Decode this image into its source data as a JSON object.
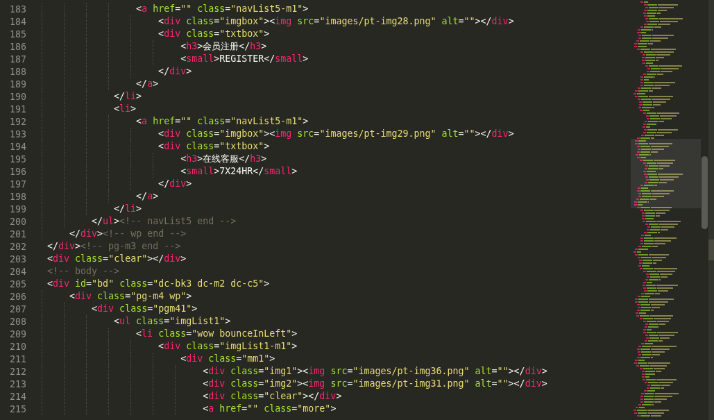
{
  "editor": {
    "lines": [
      {
        "number": "183",
        "tokens": [
          {
            "kind": "punct",
            "text": "                <"
          },
          {
            "kind": "tag",
            "text": "a"
          },
          {
            "kind": "attr",
            "text": " href"
          },
          {
            "kind": "punct",
            "text": "="
          },
          {
            "kind": "string",
            "text": "\"\""
          },
          {
            "kind": "attr",
            "text": " class"
          },
          {
            "kind": "punct",
            "text": "="
          },
          {
            "kind": "string",
            "text": "\"navList5-m1\""
          },
          {
            "kind": "punct",
            "text": ">"
          }
        ]
      },
      {
        "number": "184",
        "tokens": [
          {
            "kind": "punct",
            "text": "                    <"
          },
          {
            "kind": "tag",
            "text": "div"
          },
          {
            "kind": "attr",
            "text": " class"
          },
          {
            "kind": "punct",
            "text": "="
          },
          {
            "kind": "string",
            "text": "\"imgbox\""
          },
          {
            "kind": "punct",
            "text": "><"
          },
          {
            "kind": "tag",
            "text": "img"
          },
          {
            "kind": "attr",
            "text": " src"
          },
          {
            "kind": "punct",
            "text": "="
          },
          {
            "kind": "string",
            "text": "\"images/pt-img28.png\""
          },
          {
            "kind": "attr",
            "text": " alt"
          },
          {
            "kind": "punct",
            "text": "="
          },
          {
            "kind": "string",
            "text": "\"\""
          },
          {
            "kind": "punct",
            "text": "></"
          },
          {
            "kind": "tag",
            "text": "div"
          },
          {
            "kind": "punct",
            "text": ">"
          }
        ]
      },
      {
        "number": "185",
        "tokens": [
          {
            "kind": "punct",
            "text": "                    <"
          },
          {
            "kind": "tag",
            "text": "div"
          },
          {
            "kind": "attr",
            "text": " class"
          },
          {
            "kind": "punct",
            "text": "="
          },
          {
            "kind": "string",
            "text": "\"txtbox\""
          },
          {
            "kind": "punct",
            "text": ">"
          }
        ]
      },
      {
        "number": "186",
        "tokens": [
          {
            "kind": "punct",
            "text": "                        <"
          },
          {
            "kind": "tag",
            "text": "h3"
          },
          {
            "kind": "punct",
            "text": ">会员注册</"
          },
          {
            "kind": "tag",
            "text": "h3"
          },
          {
            "kind": "punct",
            "text": ">"
          }
        ]
      },
      {
        "number": "187",
        "tokens": [
          {
            "kind": "punct",
            "text": "                        <"
          },
          {
            "kind": "tag",
            "text": "small"
          },
          {
            "kind": "punct",
            "text": ">REGISTER</"
          },
          {
            "kind": "tag",
            "text": "small"
          },
          {
            "kind": "punct",
            "text": ">"
          }
        ]
      },
      {
        "number": "188",
        "tokens": [
          {
            "kind": "punct",
            "text": "                    </"
          },
          {
            "kind": "tag",
            "text": "div"
          },
          {
            "kind": "punct",
            "text": ">"
          }
        ]
      },
      {
        "number": "189",
        "tokens": [
          {
            "kind": "punct",
            "text": "                </"
          },
          {
            "kind": "tag",
            "text": "a"
          },
          {
            "kind": "punct",
            "text": ">"
          }
        ]
      },
      {
        "number": "190",
        "tokens": [
          {
            "kind": "punct",
            "text": "            </"
          },
          {
            "kind": "tag",
            "text": "li"
          },
          {
            "kind": "punct",
            "text": ">"
          }
        ]
      },
      {
        "number": "191",
        "tokens": [
          {
            "kind": "punct",
            "text": "            <"
          },
          {
            "kind": "tag",
            "text": "li"
          },
          {
            "kind": "punct",
            "text": ">"
          }
        ]
      },
      {
        "number": "192",
        "tokens": [
          {
            "kind": "punct",
            "text": "                <"
          },
          {
            "kind": "tag",
            "text": "a"
          },
          {
            "kind": "attr",
            "text": " href"
          },
          {
            "kind": "punct",
            "text": "="
          },
          {
            "kind": "string",
            "text": "\"\""
          },
          {
            "kind": "attr",
            "text": " class"
          },
          {
            "kind": "punct",
            "text": "="
          },
          {
            "kind": "string",
            "text": "\"navList5-m1\""
          },
          {
            "kind": "punct",
            "text": ">"
          }
        ]
      },
      {
        "number": "193",
        "tokens": [
          {
            "kind": "punct",
            "text": "                    <"
          },
          {
            "kind": "tag",
            "text": "div"
          },
          {
            "kind": "attr",
            "text": " class"
          },
          {
            "kind": "punct",
            "text": "="
          },
          {
            "kind": "string",
            "text": "\"imgbox\""
          },
          {
            "kind": "punct",
            "text": "><"
          },
          {
            "kind": "tag",
            "text": "img"
          },
          {
            "kind": "attr",
            "text": " src"
          },
          {
            "kind": "punct",
            "text": "="
          },
          {
            "kind": "string",
            "text": "\"images/pt-img29.png\""
          },
          {
            "kind": "attr",
            "text": " alt"
          },
          {
            "kind": "punct",
            "text": "="
          },
          {
            "kind": "string",
            "text": "\"\""
          },
          {
            "kind": "punct",
            "text": "></"
          },
          {
            "kind": "tag",
            "text": "div"
          },
          {
            "kind": "punct",
            "text": ">"
          }
        ]
      },
      {
        "number": "194",
        "tokens": [
          {
            "kind": "punct",
            "text": "                    <"
          },
          {
            "kind": "tag",
            "text": "div"
          },
          {
            "kind": "attr",
            "text": " class"
          },
          {
            "kind": "punct",
            "text": "="
          },
          {
            "kind": "string",
            "text": "\"txtbox\""
          },
          {
            "kind": "punct",
            "text": ">"
          }
        ]
      },
      {
        "number": "195",
        "tokens": [
          {
            "kind": "punct",
            "text": "                        <"
          },
          {
            "kind": "tag",
            "text": "h3"
          },
          {
            "kind": "punct",
            "text": ">在线客服</"
          },
          {
            "kind": "tag",
            "text": "h3"
          },
          {
            "kind": "punct",
            "text": ">"
          }
        ]
      },
      {
        "number": "196",
        "tokens": [
          {
            "kind": "punct",
            "text": "                        <"
          },
          {
            "kind": "tag",
            "text": "small"
          },
          {
            "kind": "punct",
            "text": ">7X24HR</"
          },
          {
            "kind": "tag",
            "text": "small"
          },
          {
            "kind": "punct",
            "text": ">"
          }
        ]
      },
      {
        "number": "197",
        "tokens": [
          {
            "kind": "punct",
            "text": "                    </"
          },
          {
            "kind": "tag",
            "text": "div"
          },
          {
            "kind": "punct",
            "text": ">"
          }
        ]
      },
      {
        "number": "198",
        "tokens": [
          {
            "kind": "punct",
            "text": "                </"
          },
          {
            "kind": "tag",
            "text": "a"
          },
          {
            "kind": "punct",
            "text": ">"
          }
        ]
      },
      {
        "number": "199",
        "tokens": [
          {
            "kind": "punct",
            "text": "            </"
          },
          {
            "kind": "tag",
            "text": "li"
          },
          {
            "kind": "punct",
            "text": ">"
          }
        ]
      },
      {
        "number": "200",
        "tokens": [
          {
            "kind": "punct",
            "text": "        </"
          },
          {
            "kind": "tag",
            "text": "ul"
          },
          {
            "kind": "punct",
            "text": ">"
          },
          {
            "kind": "comment",
            "text": "<!-- navList5 end -->"
          }
        ]
      },
      {
        "number": "201",
        "tokens": [
          {
            "kind": "punct",
            "text": "    </"
          },
          {
            "kind": "tag",
            "text": "div"
          },
          {
            "kind": "punct",
            "text": ">"
          },
          {
            "kind": "comment",
            "text": "<!-- wp end -->"
          }
        ]
      },
      {
        "number": "202",
        "tokens": [
          {
            "kind": "punct",
            "text": "</"
          },
          {
            "kind": "tag",
            "text": "div"
          },
          {
            "kind": "punct",
            "text": ">"
          },
          {
            "kind": "comment",
            "text": "<!-- pg-m3 end -->"
          }
        ]
      },
      {
        "number": "203",
        "tokens": [
          {
            "kind": "punct",
            "text": "<"
          },
          {
            "kind": "tag",
            "text": "div"
          },
          {
            "kind": "attr",
            "text": " class"
          },
          {
            "kind": "punct",
            "text": "="
          },
          {
            "kind": "string",
            "text": "\"clear\""
          },
          {
            "kind": "punct",
            "text": "></"
          },
          {
            "kind": "tag",
            "text": "div"
          },
          {
            "kind": "punct",
            "text": ">"
          }
        ]
      },
      {
        "number": "204",
        "tokens": [
          {
            "kind": "comment",
            "text": "<!-- body -->"
          }
        ]
      },
      {
        "number": "205",
        "tokens": [
          {
            "kind": "punct",
            "text": "<"
          },
          {
            "kind": "tag",
            "text": "div"
          },
          {
            "kind": "attr",
            "text": " id"
          },
          {
            "kind": "punct",
            "text": "="
          },
          {
            "kind": "string",
            "text": "\"bd\""
          },
          {
            "kind": "attr",
            "text": " class"
          },
          {
            "kind": "punct",
            "text": "="
          },
          {
            "kind": "string",
            "text": "\"dc-bk3 dc-m2 dc-c5\""
          },
          {
            "kind": "punct",
            "text": ">"
          }
        ]
      },
      {
        "number": "206",
        "tokens": [
          {
            "kind": "punct",
            "text": "    <"
          },
          {
            "kind": "tag",
            "text": "div"
          },
          {
            "kind": "attr",
            "text": " class"
          },
          {
            "kind": "punct",
            "text": "="
          },
          {
            "kind": "string",
            "text": "\"pg-m4 wp\""
          },
          {
            "kind": "punct",
            "text": ">"
          }
        ]
      },
      {
        "number": "207",
        "tokens": [
          {
            "kind": "punct",
            "text": "        <"
          },
          {
            "kind": "tag",
            "text": "div"
          },
          {
            "kind": "attr",
            "text": " class"
          },
          {
            "kind": "punct",
            "text": "="
          },
          {
            "kind": "string",
            "text": "\"pgm41\""
          },
          {
            "kind": "punct",
            "text": ">"
          }
        ]
      },
      {
        "number": "208",
        "tokens": [
          {
            "kind": "punct",
            "text": "            <"
          },
          {
            "kind": "tag",
            "text": "ul"
          },
          {
            "kind": "attr",
            "text": " class"
          },
          {
            "kind": "punct",
            "text": "="
          },
          {
            "kind": "string",
            "text": "\"imgList1\""
          },
          {
            "kind": "punct",
            "text": ">"
          }
        ]
      },
      {
        "number": "209",
        "tokens": [
          {
            "kind": "punct",
            "text": "                <"
          },
          {
            "kind": "tag",
            "text": "li"
          },
          {
            "kind": "attr",
            "text": " class"
          },
          {
            "kind": "punct",
            "text": "="
          },
          {
            "kind": "string",
            "text": "\"wow bounceInLeft\""
          },
          {
            "kind": "punct",
            "text": ">"
          }
        ]
      },
      {
        "number": "210",
        "tokens": [
          {
            "kind": "punct",
            "text": "                    <"
          },
          {
            "kind": "tag",
            "text": "div"
          },
          {
            "kind": "attr",
            "text": " class"
          },
          {
            "kind": "punct",
            "text": "="
          },
          {
            "kind": "string",
            "text": "\"imgList1-m1\""
          },
          {
            "kind": "punct",
            "text": ">"
          }
        ]
      },
      {
        "number": "211",
        "tokens": [
          {
            "kind": "punct",
            "text": "                        <"
          },
          {
            "kind": "tag",
            "text": "div"
          },
          {
            "kind": "attr",
            "text": " class"
          },
          {
            "kind": "punct",
            "text": "="
          },
          {
            "kind": "string",
            "text": "\"mm1\""
          },
          {
            "kind": "punct",
            "text": ">"
          }
        ]
      },
      {
        "number": "212",
        "tokens": [
          {
            "kind": "punct",
            "text": "                            <"
          },
          {
            "kind": "tag",
            "text": "div"
          },
          {
            "kind": "attr",
            "text": " class"
          },
          {
            "kind": "punct",
            "text": "="
          },
          {
            "kind": "string",
            "text": "\"img1\""
          },
          {
            "kind": "punct",
            "text": "><"
          },
          {
            "kind": "tag",
            "text": "img"
          },
          {
            "kind": "attr",
            "text": " src"
          },
          {
            "kind": "punct",
            "text": "="
          },
          {
            "kind": "string",
            "text": "\"images/pt-img36.png\""
          },
          {
            "kind": "attr",
            "text": " alt"
          },
          {
            "kind": "punct",
            "text": "="
          },
          {
            "kind": "string",
            "text": "\"\""
          },
          {
            "kind": "punct",
            "text": "></"
          },
          {
            "kind": "tag",
            "text": "div"
          },
          {
            "kind": "punct",
            "text": ">"
          }
        ]
      },
      {
        "number": "213",
        "tokens": [
          {
            "kind": "punct",
            "text": "                            <"
          },
          {
            "kind": "tag",
            "text": "div"
          },
          {
            "kind": "attr",
            "text": " class"
          },
          {
            "kind": "punct",
            "text": "="
          },
          {
            "kind": "string",
            "text": "\"img2\""
          },
          {
            "kind": "punct",
            "text": "><"
          },
          {
            "kind": "tag",
            "text": "img"
          },
          {
            "kind": "attr",
            "text": " src"
          },
          {
            "kind": "punct",
            "text": "="
          },
          {
            "kind": "string",
            "text": "\"images/pt-img31.png\""
          },
          {
            "kind": "attr",
            "text": " alt"
          },
          {
            "kind": "punct",
            "text": "="
          },
          {
            "kind": "string",
            "text": "\"\""
          },
          {
            "kind": "punct",
            "text": "></"
          },
          {
            "kind": "tag",
            "text": "div"
          },
          {
            "kind": "punct",
            "text": ">"
          }
        ]
      },
      {
        "number": "214",
        "tokens": [
          {
            "kind": "punct",
            "text": "                            <"
          },
          {
            "kind": "tag",
            "text": "div"
          },
          {
            "kind": "attr",
            "text": " class"
          },
          {
            "kind": "punct",
            "text": "="
          },
          {
            "kind": "string",
            "text": "\"clear\""
          },
          {
            "kind": "punct",
            "text": "></"
          },
          {
            "kind": "tag",
            "text": "div"
          },
          {
            "kind": "punct",
            "text": ">"
          }
        ]
      },
      {
        "number": "215",
        "tokens": [
          {
            "kind": "punct",
            "text": "                            <"
          },
          {
            "kind": "tag",
            "text": "a"
          },
          {
            "kind": "attr",
            "text": " href"
          },
          {
            "kind": "punct",
            "text": "="
          },
          {
            "kind": "string",
            "text": "\"\""
          },
          {
            "kind": "attr",
            "text": " class"
          },
          {
            "kind": "punct",
            "text": "="
          },
          {
            "kind": "string",
            "text": "\"more\""
          },
          {
            "kind": "punct",
            "text": ">"
          }
        ]
      }
    ]
  }
}
